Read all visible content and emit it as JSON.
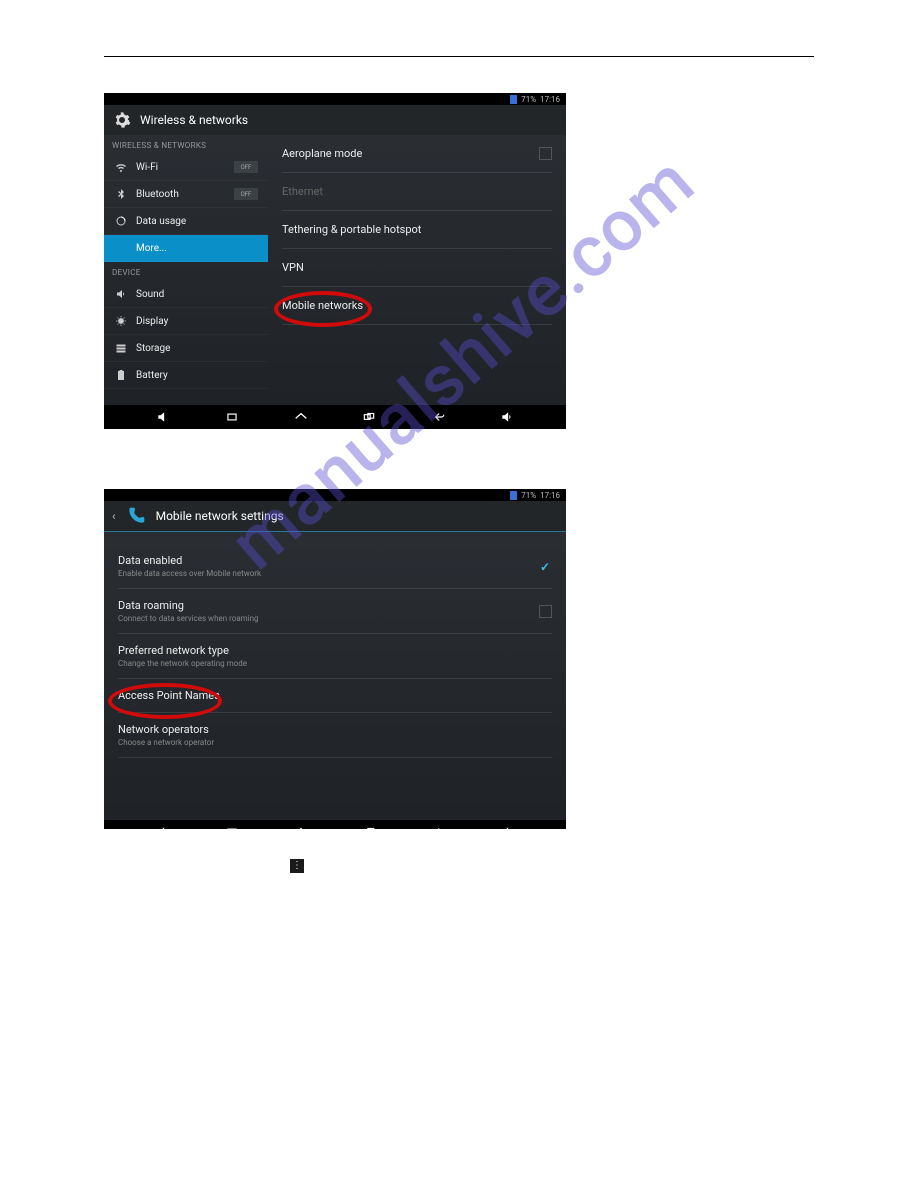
{
  "status": {
    "battery": "71%",
    "time": "17:16"
  },
  "shot1": {
    "title": "Wireless & networks",
    "sidebar": {
      "hdr1": "WIRELESS & NETWORKS",
      "wifi": "Wi-Fi",
      "bt": "Bluetooth",
      "off": "OFF",
      "data": "Data usage",
      "more": "More...",
      "hdr2": "DEVICE",
      "sound": "Sound",
      "display": "Display",
      "storage": "Storage",
      "battery": "Battery"
    },
    "right": {
      "aero": "Aeroplane mode",
      "eth": "Ethernet",
      "teth": "Tethering & portable hotspot",
      "vpn": "VPN",
      "mn": "Mobile networks"
    }
  },
  "shot2": {
    "title": "Mobile network settings",
    "items": {
      "de_t": "Data enabled",
      "de_s": "Enable data access over Mobile network",
      "dr_t": "Data roaming",
      "dr_s": "Connect to data services when roaming",
      "pn_t": "Preferred network type",
      "pn_s": "Change the network operating mode",
      "apn_t": "Access Point Names",
      "no_t": "Network operators",
      "no_s": "Choose a network operator"
    }
  },
  "watermark": "manualshive.com"
}
